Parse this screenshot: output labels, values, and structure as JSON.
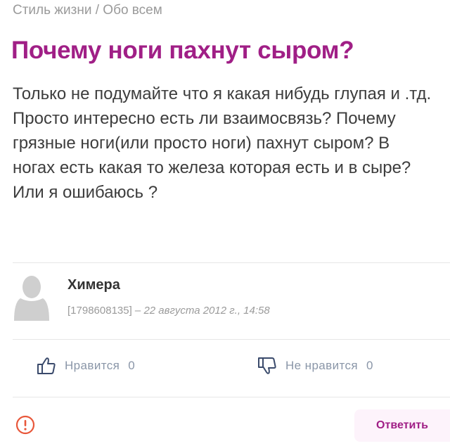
{
  "breadcrumb": {
    "category": "Стиль жизни",
    "separator": " / ",
    "subcategory": "Обо всем"
  },
  "question": {
    "title": "Почему ноги пахнут сыром?",
    "body": "Только не подумайте что я какая нибудь глупая и .тд. Просто интересно есть ли взаимосвязь? Почему грязные ноги(или просто ноги) пахнут сыром? В ногах есть какая то железа которая есть и в сыре? Или я ошибаюсь ?"
  },
  "author": {
    "name": "Химера",
    "id": "[1798608135]",
    "separator": " – ",
    "date": "22 августа 2012 г., 14:58",
    "avatar_icon": "user-silhouette-icon"
  },
  "reactions": {
    "like_label": "Нравится",
    "like_count": "0",
    "like_icon": "thumbs-up-icon",
    "dislike_label": "Не нравится",
    "dislike_count": "0",
    "dislike_icon": "thumbs-down-icon"
  },
  "actions": {
    "report_icon": "exclamation-circle-icon",
    "reply_label": "Ответить"
  },
  "colors": {
    "accent": "#a01f86",
    "muted_text": "#9a9a9a",
    "reaction_text": "#8a96a8",
    "report_icon": "#e8573a",
    "reply_background": "#fdf3fb"
  }
}
